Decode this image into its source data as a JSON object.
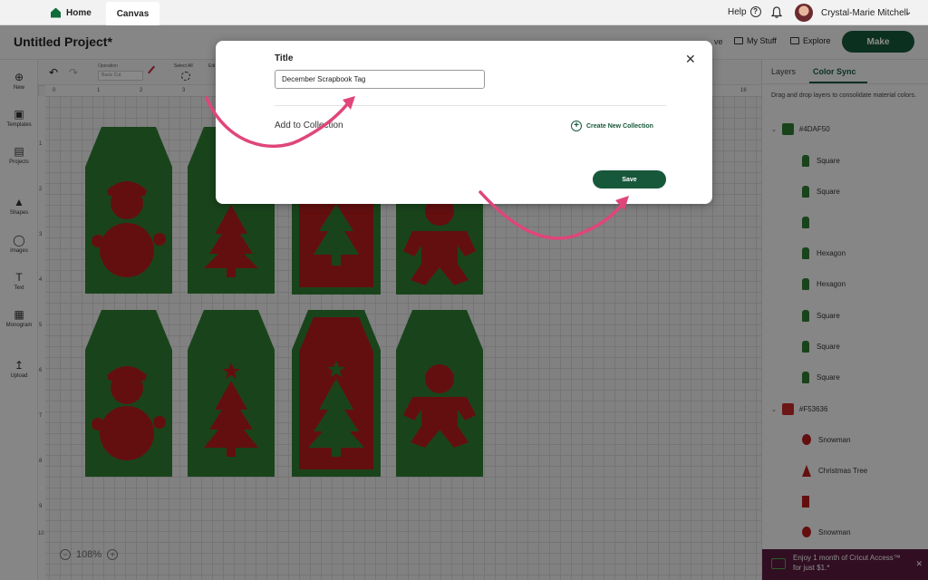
{
  "nav": {
    "home_label": "Home",
    "canvas_label": "Canvas",
    "help_label": "Help",
    "user_name": "Crystal-Marie Mitchell"
  },
  "project": {
    "title": "Untitled Project*",
    "save_label": "ve",
    "mystuff_label": "My Stuff",
    "explore_label": "Explore",
    "make_label": "Make"
  },
  "sidebar": {
    "items": [
      {
        "label": "New",
        "icon": "plus-circle-icon"
      },
      {
        "label": "Templates",
        "icon": "shirt-icon"
      },
      {
        "label": "Projects",
        "icon": "clipboard-icon"
      },
      {
        "label": "Shapes",
        "icon": "shapes-icon"
      },
      {
        "label": "Images",
        "icon": "bulb-icon"
      },
      {
        "label": "Text",
        "icon": "text-icon"
      },
      {
        "label": "Monogram",
        "icon": "monogram-icon"
      },
      {
        "label": "Upload",
        "icon": "upload-icon"
      }
    ]
  },
  "toolbar": {
    "operation_label": "Operation",
    "operation_value": "Basic Cut",
    "select_all_label": "Select All",
    "edit_label": "Edi"
  },
  "ruler": {
    "top": [
      "0",
      "1",
      "2",
      "3",
      "16"
    ],
    "left": [
      "1",
      "2",
      "3",
      "4",
      "5",
      "6",
      "7",
      "8",
      "9",
      "10"
    ]
  },
  "canvas": {
    "zoom": "108%"
  },
  "colors": {
    "green": "#2e7d32",
    "red": "#b71c1c",
    "brand": "#17583b"
  },
  "right_panel": {
    "tab_layers": "Layers",
    "tab_color_sync": "Color Sync",
    "help_text": "Drag and drop layers to consolidate material colors.",
    "groups": [
      {
        "color": "#4DAF50",
        "swatch": "#2e7d32",
        "layers": [
          "Square",
          "Square",
          "",
          "Hexagon",
          "Hexagon",
          "Square",
          "Square",
          "Square"
        ]
      },
      {
        "color": "#F53636",
        "swatch": "#c62828",
        "layers": [
          "Snowman",
          "Christmas Tree",
          "",
          "Snowman"
        ]
      }
    ]
  },
  "promo": {
    "text": "Enjoy 1 month of Cricut Access™ for just $1.*"
  },
  "modal": {
    "title_label": "Title",
    "title_value": "December Scrapbook Tag",
    "collection_label": "Add to Collection",
    "create_collection_label": "Create New Collection",
    "save_label": "Save"
  }
}
